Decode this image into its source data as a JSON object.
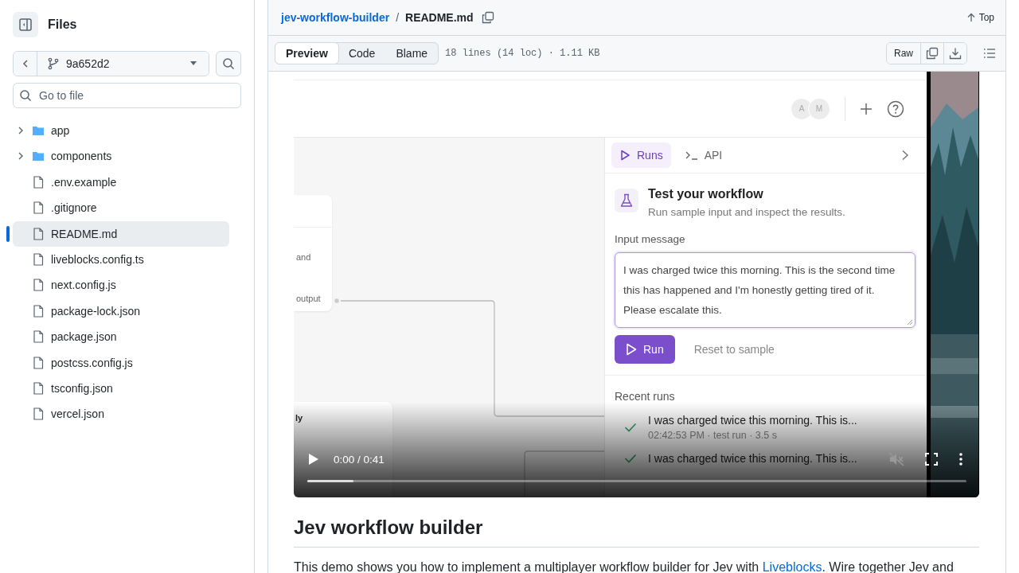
{
  "sidebar": {
    "title": "Files",
    "branch": "9a652d2",
    "search": {
      "placeholder": "Go to file"
    },
    "tree": [
      {
        "name": "app",
        "kind": "folder",
        "expanded": false,
        "selected": false
      },
      {
        "name": "components",
        "kind": "folder",
        "expanded": false,
        "selected": false
      },
      {
        "name": ".env.example",
        "kind": "file",
        "selected": false
      },
      {
        "name": ".gitignore",
        "kind": "file",
        "selected": false
      },
      {
        "name": "README.md",
        "kind": "file",
        "selected": true
      },
      {
        "name": "liveblocks.config.ts",
        "kind": "file",
        "selected": false
      },
      {
        "name": "next.config.js",
        "kind": "file",
        "selected": false
      },
      {
        "name": "package-lock.json",
        "kind": "file",
        "selected": false
      },
      {
        "name": "package.json",
        "kind": "file",
        "selected": false
      },
      {
        "name": "postcss.config.js",
        "kind": "file",
        "selected": false
      },
      {
        "name": "tsconfig.json",
        "kind": "file",
        "selected": false
      },
      {
        "name": "vercel.json",
        "kind": "file",
        "selected": false
      }
    ]
  },
  "header": {
    "repo": "jev-workflow-builder",
    "separator": "/",
    "file": "README.md",
    "top": "Top"
  },
  "toolbar": {
    "tabs": [
      {
        "label": "Preview",
        "selected": true
      },
      {
        "label": "Code",
        "selected": false
      },
      {
        "label": "Blame",
        "selected": false
      }
    ],
    "file_info": "18 lines (14 loc) · 1.11 KB",
    "raw": "Raw"
  },
  "video": {
    "app": {
      "avatars": [
        "A",
        "M"
      ],
      "canvas_nodes": [
        {
          "texts": [
            "and",
            "output"
          ]
        },
        {
          "texts": [
            "ly"
          ]
        }
      ],
      "panel_tabs": [
        {
          "label": "Runs",
          "selected": true
        },
        {
          "label": "API",
          "selected": false
        }
      ],
      "test_title": "Test your workflow",
      "test_subtitle": "Run sample input and inspect the results.",
      "input_label": "Input message",
      "input_value": "I was charged twice this morning. This is the second time this has happened and I'm honestly getting tired of it. Please escalate this.",
      "run": "Run",
      "reset": "Reset to sample",
      "recent_title": "Recent runs",
      "runs": [
        {
          "title": "I was charged twice this morning. This is...",
          "meta": "02:42:53 PM · test run · 3.5 s",
          "succeeded": true
        },
        {
          "title": "I was charged twice this morning. This is...",
          "succeeded": true
        }
      ]
    },
    "time": "0:00 / 0:41",
    "progress": {
      "level": 0.07
    }
  },
  "readme": {
    "heading": "Jev workflow builder",
    "paragraph": {
      "before": "This demo shows you how to implement a multiplayer workflow builder for Jev with",
      "link": "Liveblocks",
      "after": ". Wire together Jev and"
    }
  }
}
